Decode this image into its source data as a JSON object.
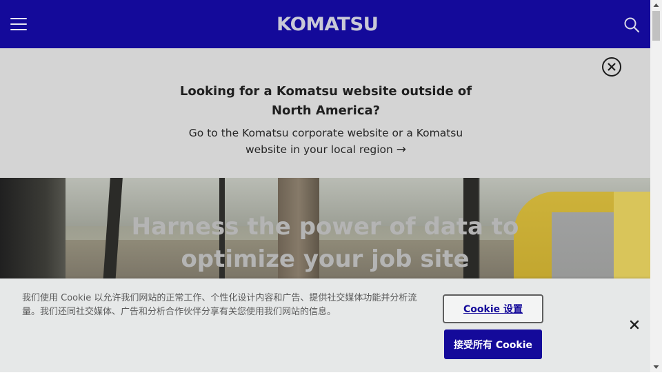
{
  "header": {
    "logo_text": "KOMATSU",
    "menu_icon": "hamburger-menu-icon",
    "search_icon": "search-icon",
    "background": "#140a9a"
  },
  "region_banner": {
    "title": "Looking for a Komatsu website outside of North America?",
    "link_text": "Go to the Komatsu corporate website or a Komatsu website in your local region",
    "link_arrow": "→",
    "close_icon": "close-circle-icon"
  },
  "hero": {
    "title": "Harness the power of data to optimize your job site"
  },
  "cookie_banner": {
    "text": "我们使用 Cookie 以允许我们网站的正常工作、个性化设计内容和广告、提供社交媒体功能并分析流量。我们还同社交媒体、广告和分析合作伙伴分享有关您使用我们网站的信息。",
    "settings_label": "Cookie 设置",
    "accept_label": "接受所有 Cookie",
    "close_icon": "close-x-icon",
    "accent_color": "#140a9a"
  }
}
